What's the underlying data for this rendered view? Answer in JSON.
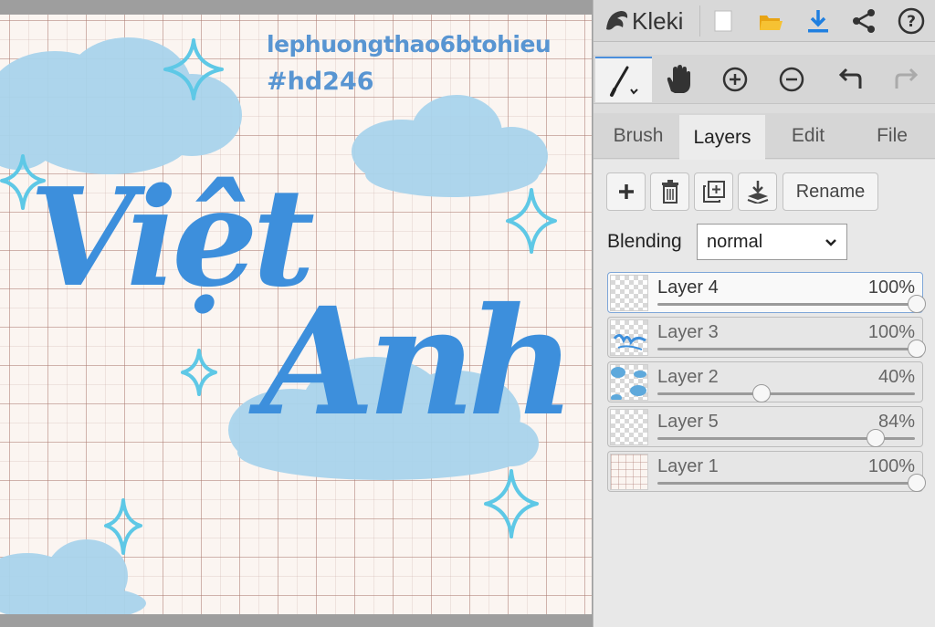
{
  "app": {
    "name": "Kleki",
    "toolbar": {
      "new_icon": "new-file-icon",
      "open_icon": "open-folder-icon",
      "save_icon": "download-icon",
      "share_icon": "share-icon",
      "help_icon": "help-icon"
    }
  },
  "tools": [
    {
      "name": "brush-tool",
      "icon": "brush-icon"
    },
    {
      "name": "hand-tool",
      "icon": "hand-icon"
    },
    {
      "name": "zoom-in",
      "icon": "zoom-in-icon"
    },
    {
      "name": "zoom-out",
      "icon": "zoom-out-icon"
    },
    {
      "name": "undo",
      "icon": "undo-icon"
    },
    {
      "name": "redo",
      "icon": "redo-icon"
    }
  ],
  "tabs": [
    "Brush",
    "Layers",
    "Edit",
    "File"
  ],
  "active_tab": "Layers",
  "layer_panel": {
    "rename_label": "Rename",
    "blending_label": "Blending",
    "blending_value": "normal",
    "layers": [
      {
        "name": "Layer 4",
        "opacity_label": "100%",
        "opacity": 1.0,
        "selected": true
      },
      {
        "name": "Layer 3",
        "opacity_label": "100%",
        "opacity": 1.0,
        "selected": false
      },
      {
        "name": "Layer 2",
        "opacity_label": "40%",
        "opacity": 0.4,
        "selected": false
      },
      {
        "name": "Layer 5",
        "opacity_label": "84%",
        "opacity": 0.84,
        "selected": false
      },
      {
        "name": "Layer 1",
        "opacity_label": "100%",
        "opacity": 1.0,
        "selected": false
      }
    ]
  },
  "artwork": {
    "caption": "lephuongthao6btohieu",
    "hashtag": "#hd246",
    "word1": "Việt",
    "word2": "Anh"
  },
  "colors": {
    "accent": "#4b8fdc",
    "lettering": "#3d8fdc",
    "cloud": "#a9d4ec",
    "sparkle": "#5ec8e6"
  }
}
